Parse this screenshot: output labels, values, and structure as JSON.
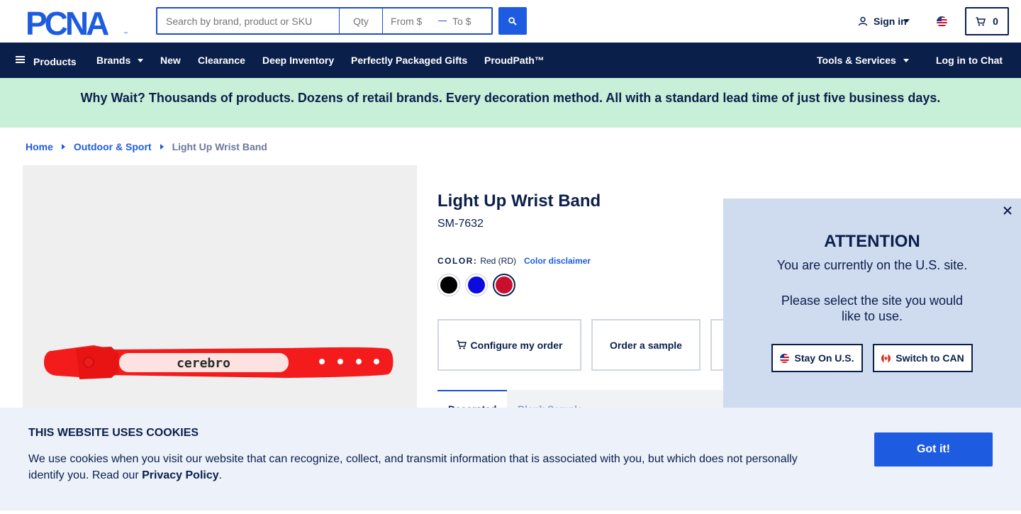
{
  "header": {
    "logo_text": "PCNA",
    "search_placeholder": "Search by brand, product or SKU",
    "qty_placeholder": "Qty",
    "from_placeholder": "From $",
    "to_placeholder": "To $",
    "sign_in_label": "Sign in",
    "cart_count": "0"
  },
  "nav": {
    "products": "Products",
    "brands": "Brands",
    "new": "New",
    "clearance": "Clearance",
    "deep_inventory": "Deep Inventory",
    "gifts": "Perfectly Packaged Gifts",
    "proudpath": "ProudPath™",
    "tools": "Tools & Services",
    "chat": "Log in to Chat"
  },
  "banner": {
    "text": "Why Wait? Thousands of products. Dozens of retail brands. Every decoration method. All with a standard lead time of just five business days."
  },
  "breadcrumb": {
    "home": "Home",
    "category": "Outdoor & Sport",
    "current": "Light Up Wrist Band"
  },
  "product": {
    "image_print": "cerebro",
    "title": "Light Up Wrist Band",
    "sku": "SM-7632",
    "color_label": "COLOR:",
    "color_value": "Red (RD)",
    "color_disclaimer": "Color disclaimer",
    "swatches": [
      {
        "name": "black",
        "hex": "#000000"
      },
      {
        "name": "blue",
        "hex": "#0b0bdf"
      },
      {
        "name": "red",
        "hex": "#c8102e"
      }
    ],
    "configure_label": "Configure my order",
    "sample_label": "Order a sample",
    "tab_decorated": "Decorated",
    "tab_blank": "Blank Sample"
  },
  "region_modal": {
    "title": "ATTENTION",
    "line1": "You are currently on the U.S. site.",
    "line2": "Please select the site you would like to use.",
    "stay_label": "Stay On U.S.",
    "switch_label": "Switch to CAN"
  },
  "cookie": {
    "title": "THIS WEBSITE USES COOKIES",
    "text": "We use cookies when you visit our website that can recognize, collect, and transmit information that is associated with you, but which does not personally identify you. Read our",
    "link": "Privacy Policy",
    "period": ".",
    "button": "Got it!"
  },
  "colors": {
    "navy": "#0b1f4b",
    "brand_blue": "#1d5ce0",
    "banner_green": "#c8f0d8",
    "modal_bg": "#cfdbef",
    "cookie_bg": "#ecf1fa"
  }
}
